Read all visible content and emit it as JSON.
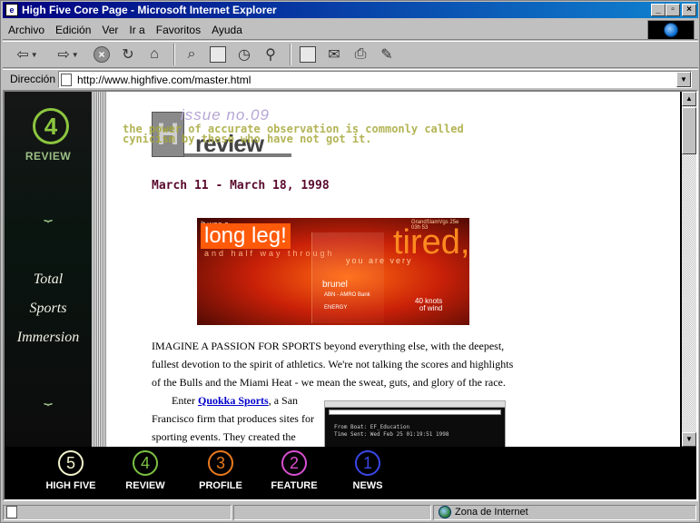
{
  "window": {
    "title": "High Five Core Page - Microsoft Internet Explorer",
    "min_label": "_",
    "max_label": "▫",
    "close_label": "×"
  },
  "menu": [
    "Archivo",
    "Edición",
    "Ver",
    "Ir a",
    "Favoritos",
    "Ayuda"
  ],
  "address": {
    "label": "Dirección",
    "url": "http://www.highfive.com/master.html"
  },
  "left_nav": {
    "issue_number": "4",
    "issue_label": "REVIEW",
    "sections": [
      "Total",
      "Sports",
      "Immersion"
    ]
  },
  "header": {
    "issue": "issue no.09",
    "review_word": "review",
    "logo_letter": "H",
    "quote": "the power of accurate observation is commonly called cynicism by those who have not got it."
  },
  "date": "March 11 - March 18, 1998",
  "hero": {
    "small_top": "It was a",
    "line1": "long leg!",
    "line2": "and half way through",
    "line3": "you are very",
    "word": "tired,",
    "sponsor": "brunel",
    "bank": "ABN - AMRO Bank",
    "energy": "ENERGY",
    "knots": "40 knots",
    "wind": "of wind",
    "corner_tag": "GrandSlamVgs 25e 03h 53"
  },
  "article": {
    "paragraph1": "IMAGINE A PASSION FOR SPORTS beyond everything else, with the deepest, fullest devotion to the spirit of athletics. We're not talking the scores and highlights of the Bulls and the Miami Heat - we mean the sweat, guts, and glory of the race.",
    "p2_before": "Enter ",
    "p2_link": "Quokka Sports",
    "p2_after": ", a San Francisco firm that produces sites for sporting events. They created the"
  },
  "inset": {
    "line1": "From Boat: EF_Education",
    "line2": "Time Sent: Wed Feb 25 01:19:51 1998"
  },
  "bottom_nav": [
    {
      "number": "5",
      "label": "HIGH FIVE",
      "color": "#f2f2cc"
    },
    {
      "number": "4",
      "label": "REVIEW",
      "color": "#7cc142"
    },
    {
      "number": "3",
      "label": "PROFILE",
      "color": "#e8791e"
    },
    {
      "number": "2",
      "label": "FEATURE",
      "color": "#d84fd0"
    },
    {
      "number": "1",
      "label": "NEWS",
      "color": "#3a46e6"
    }
  ],
  "status": {
    "zone": "Zona de Internet"
  },
  "icons": [
    "back-arrow-icon",
    "forward-arrow-icon",
    "stop-icon",
    "refresh-icon",
    "home-icon",
    "search-icon",
    "favorites-icon",
    "history-icon",
    "channels-icon",
    "fullscreen-icon",
    "mail-icon",
    "print-icon",
    "edit-icon",
    "ie-globe-icon"
  ]
}
